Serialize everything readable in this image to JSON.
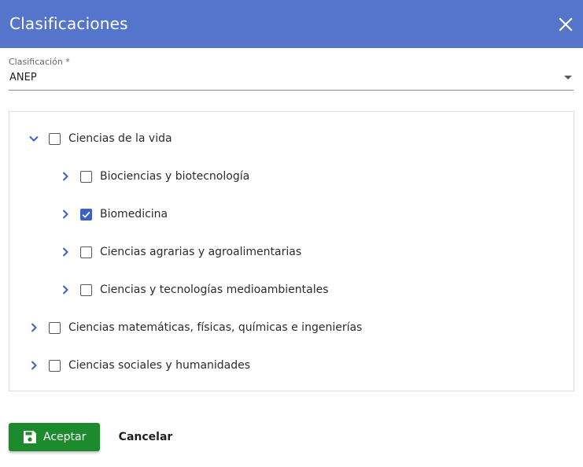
{
  "dialog": {
    "title": "Clasificaciones",
    "header_color": "#5574cc"
  },
  "field": {
    "label": "Clasificación *",
    "value": "ANEP"
  },
  "tree": {
    "nodes": [
      {
        "label": "Ciencias de la vida",
        "checked": false,
        "expanded": true
      },
      {
        "label": "Biociencias y biotecnología",
        "checked": false,
        "expanded": false
      },
      {
        "label": "Biomedicina",
        "checked": true,
        "expanded": false
      },
      {
        "label": "Ciencias agrarias y agroalimentarias",
        "checked": false,
        "expanded": false
      },
      {
        "label": "Ciencias y tecnologías medioambientales",
        "checked": false,
        "expanded": false
      },
      {
        "label": "Ciencias matemáticas, físicas, químicas e ingenierías",
        "checked": false,
        "expanded": false
      },
      {
        "label": "Ciencias sociales y humanidades",
        "checked": false,
        "expanded": false
      }
    ]
  },
  "footer": {
    "accept_label": "Aceptar",
    "cancel_label": "Cancelar",
    "accept_color": "#1e8a2e"
  },
  "icons": {
    "close": "close-icon",
    "save": "save-icon",
    "expand_more": "chevron-down-icon",
    "expand_right": "chevron-right-icon",
    "dropdown": "arrow-drop-down-icon"
  }
}
